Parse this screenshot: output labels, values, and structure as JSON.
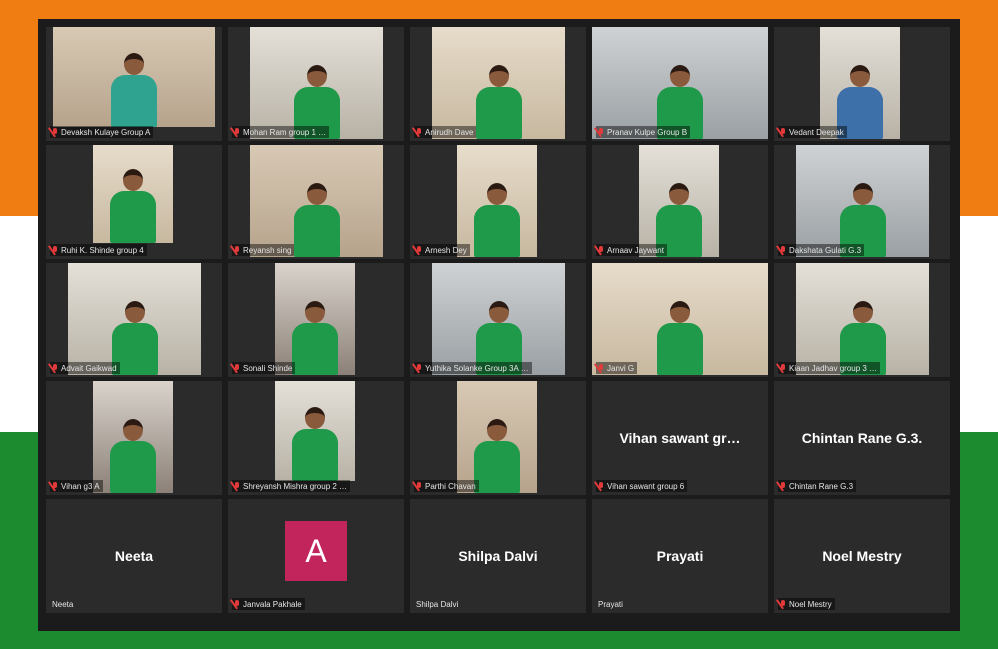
{
  "flag_colors": {
    "saffron": "#f07d12",
    "white": "#ffffff",
    "green": "#1c8a2e"
  },
  "mic_muted_icon": "mic-muted-icon",
  "participants": [
    {
      "name": "Devaksh Kulaye Group A",
      "bg": "bg-wall1",
      "video": [
        7,
        0,
        162,
        100
      ],
      "shirt": "teal",
      "muted": true
    },
    {
      "name": "Mohan Ram group 1 …",
      "bg": "bg-wall4",
      "video": [
        22,
        0,
        133,
        112
      ],
      "shirt": "green",
      "muted": true
    },
    {
      "name": "Anirudh Dave",
      "bg": "bg-wall3",
      "video": [
        22,
        0,
        133,
        112
      ],
      "shirt": "green",
      "muted": true
    },
    {
      "name": "Pranav Kulpe Group B",
      "bg": "bg-wall2",
      "video": [
        0,
        0,
        176,
        112
      ],
      "shirt": "green",
      "muted": true
    },
    {
      "name": "Vedant Deepak",
      "bg": "bg-wall4",
      "video": [
        46,
        0,
        80,
        112
      ],
      "shirt": "blue",
      "muted": true
    },
    {
      "name": "Ruhi K. Shinde group 4",
      "bg": "bg-wall3",
      "video": [
        47,
        0,
        80,
        98
      ],
      "shirt": "green",
      "muted": true
    },
    {
      "name": "Reyansh sing",
      "bg": "bg-wall1",
      "video": [
        22,
        0,
        133,
        112
      ],
      "shirt": "green",
      "muted": true
    },
    {
      "name": "Arnesh Dey",
      "bg": "bg-wall3",
      "video": [
        47,
        0,
        80,
        112
      ],
      "shirt": "green",
      "muted": true
    },
    {
      "name": "Arnaav Jaywant",
      "bg": "bg-wall4",
      "video": [
        47,
        0,
        80,
        112
      ],
      "shirt": "green",
      "muted": true
    },
    {
      "name": "Dakshata Gulati G.3",
      "bg": "bg-wall2",
      "video": [
        22,
        0,
        133,
        112
      ],
      "shirt": "green",
      "muted": true
    },
    {
      "name": "Advait Gaikwad",
      "bg": "bg-wall4",
      "video": [
        22,
        0,
        133,
        112
      ],
      "shirt": "green",
      "muted": true
    },
    {
      "name": "Sonali Shinde",
      "bg": "bg-wall5",
      "video": [
        47,
        0,
        80,
        112
      ],
      "shirt": "green",
      "muted": true
    },
    {
      "name": "Yuthika Solanke Group 3A …",
      "bg": "bg-wall2",
      "video": [
        22,
        0,
        133,
        112
      ],
      "shirt": "green",
      "muted": true
    },
    {
      "name": "Janvi G",
      "bg": "bg-wall3",
      "video": [
        0,
        0,
        176,
        112
      ],
      "shirt": "green",
      "muted": true
    },
    {
      "name": "Kiaan Jadhav group 3 …",
      "bg": "bg-wall4",
      "video": [
        22,
        0,
        133,
        112
      ],
      "shirt": "green",
      "muted": true
    },
    {
      "name": "Vihan g3 A",
      "bg": "bg-wall5",
      "video": [
        47,
        0,
        80,
        112
      ],
      "shirt": "green",
      "muted": true
    },
    {
      "name": "Shreyansh Mishra group 2 …",
      "bg": "bg-wall4",
      "video": [
        47,
        0,
        80,
        100
      ],
      "shirt": "green",
      "muted": true
    },
    {
      "name": "Parthi Chavan",
      "bg": "bg-wall1",
      "video": [
        47,
        0,
        80,
        112
      ],
      "shirt": "green",
      "muted": true
    }
  ],
  "name_tiles": [
    {
      "display": "Vihan sawant gr…",
      "label": "Vihan sawant group 6",
      "muted": true
    },
    {
      "display": "Chintan Rane G.3.",
      "label": "Chintan Rane G.3",
      "muted": true
    }
  ],
  "bottom_row": [
    {
      "display": "Neeta",
      "label": "Neeta",
      "muted": false,
      "avatar": ""
    },
    {
      "display": "",
      "label": "Janvala Pakhale",
      "muted": true,
      "avatar": "A"
    },
    {
      "display": "Shilpa Dalvi",
      "label": "Shilpa Dalvi",
      "muted": false,
      "avatar": ""
    },
    {
      "display": "Prayati",
      "label": "Prayati",
      "muted": false,
      "avatar": ""
    },
    {
      "display": "Noel Mestry",
      "label": "Noel Mestry",
      "muted": true,
      "avatar": ""
    }
  ]
}
